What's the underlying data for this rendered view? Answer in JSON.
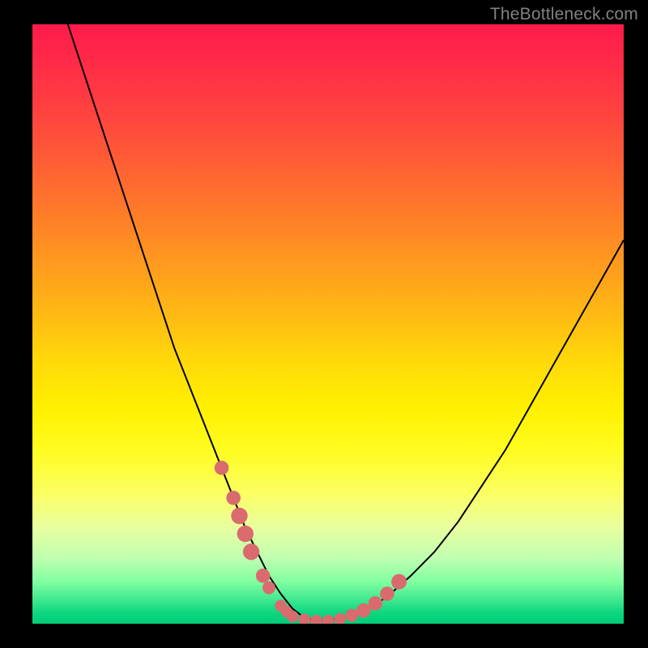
{
  "watermark": "TheBottleneck.com",
  "chart_data": {
    "type": "line",
    "title": "",
    "xlabel": "",
    "ylabel": "",
    "xlim": [
      0,
      100
    ],
    "ylim": [
      0,
      100
    ],
    "series": [
      {
        "name": "bottleneck-curve",
        "x": [
          6,
          8,
          10,
          12,
          14,
          16,
          18,
          20,
          22,
          24,
          26,
          28,
          30,
          32,
          34,
          36,
          38,
          40,
          42,
          44,
          46,
          48,
          52,
          56,
          60,
          64,
          68,
          72,
          76,
          80,
          84,
          88,
          92,
          96,
          100
        ],
        "y": [
          100,
          94,
          88,
          82,
          76,
          70,
          64,
          58,
          52,
          46,
          41,
          36,
          31,
          26,
          21,
          16,
          12,
          8,
          5,
          2.5,
          1,
          0.5,
          0.8,
          2,
          4.5,
          8,
          12,
          17,
          23,
          29,
          36,
          43,
          50,
          57,
          64
        ]
      }
    ],
    "markers": {
      "name": "highlight-dots",
      "color": "#d96b6f",
      "points": [
        {
          "x": 32,
          "y": 26,
          "r": 1.2
        },
        {
          "x": 34,
          "y": 21,
          "r": 1.2
        },
        {
          "x": 35,
          "y": 18,
          "r": 1.4
        },
        {
          "x": 36,
          "y": 15,
          "r": 1.4
        },
        {
          "x": 37,
          "y": 12,
          "r": 1.4
        },
        {
          "x": 39,
          "y": 8,
          "r": 1.2
        },
        {
          "x": 40,
          "y": 6,
          "r": 1.1
        },
        {
          "x": 42,
          "y": 3,
          "r": 1.0
        },
        {
          "x": 43,
          "y": 2,
          "r": 1.0
        },
        {
          "x": 44,
          "y": 1.2,
          "r": 1.0
        },
        {
          "x": 46,
          "y": 0.7,
          "r": 1.0
        },
        {
          "x": 48,
          "y": 0.5,
          "r": 1.0
        },
        {
          "x": 50,
          "y": 0.5,
          "r": 1.0
        },
        {
          "x": 52,
          "y": 0.8,
          "r": 1.0
        },
        {
          "x": 54,
          "y": 1.4,
          "r": 1.1
        },
        {
          "x": 56,
          "y": 2.2,
          "r": 1.2
        },
        {
          "x": 58,
          "y": 3.4,
          "r": 1.2
        },
        {
          "x": 60,
          "y": 5,
          "r": 1.2
        },
        {
          "x": 62,
          "y": 7,
          "r": 1.3
        }
      ]
    },
    "background_gradient": {
      "top": "#ff1a4a",
      "mid": "#fff000",
      "bottom": "#00cc78"
    }
  }
}
